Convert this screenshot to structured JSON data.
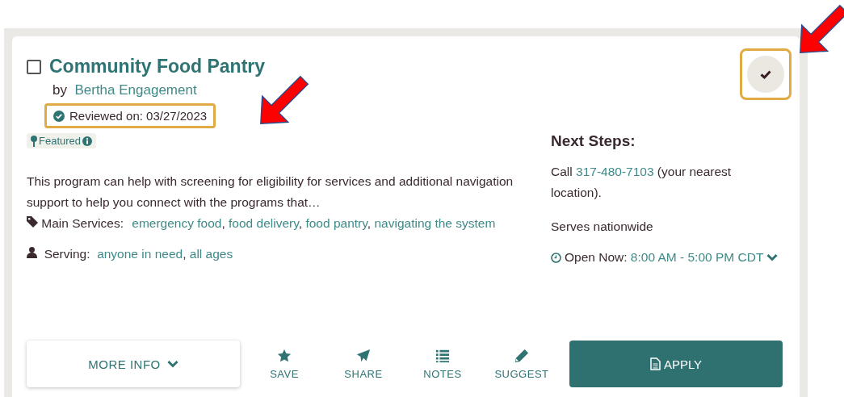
{
  "card": {
    "checked": false,
    "title": "Community Food Pantry",
    "by_label": "by",
    "author": "Bertha Engagement",
    "reviewed": "Reviewed on: 03/27/2023",
    "badge": "Featured",
    "description": "This program can help with screening for eligibility for services and additional navigation support to help you connect with the programs that…",
    "separator": ",",
    "services_label": "Main Services:",
    "services": [
      "emergency food",
      "food delivery",
      "food pantry",
      "navigating the system"
    ],
    "serving_label": "Serving:",
    "serving": [
      "anyone in need",
      "all ages"
    ]
  },
  "next_steps": {
    "heading": "Next Steps:",
    "call_prefix": "Call",
    "phone": "317-480-7103",
    "call_suffix": "(your nearest location).",
    "coverage": "Serves nationwide",
    "hours_label": "Open Now:",
    "hours": "8:00 AM - 5:00 PM CDT"
  },
  "actions": {
    "more_info": "MORE INFO",
    "tools": [
      {
        "kind": "save",
        "label": "SAVE"
      },
      {
        "kind": "share",
        "label": "SHARE"
      },
      {
        "kind": "notes",
        "label": "NOTES"
      },
      {
        "kind": "suggest",
        "label": "SUGGEST"
      }
    ],
    "apply": "APPLY"
  }
}
